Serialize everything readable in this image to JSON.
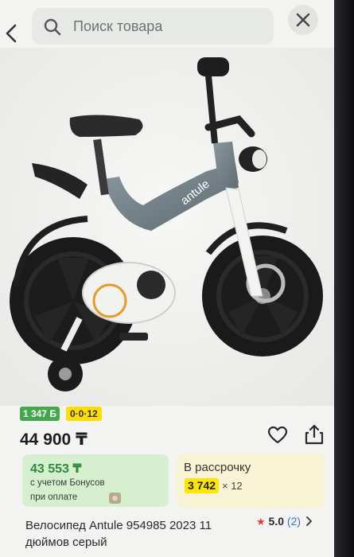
{
  "search": {
    "placeholder": "Поиск товара"
  },
  "badges": {
    "bonus": "1 347 Б",
    "installment": "0·0·12"
  },
  "product": {
    "price": "44 900 ₸",
    "title": "Велосипед Antule 954985 2023 11 дюймов серый",
    "frame_text": "antule",
    "rating": "5.0",
    "review_count": "(2)"
  },
  "bonus_card": {
    "price": "43 553 ₸",
    "note_line1": "с учетом Бонусов",
    "note_line2": "при оплате"
  },
  "installment_card": {
    "title": "В рассрочку",
    "monthly": "3 742",
    "months": "× 12"
  },
  "colors": {
    "bonus_green": "#43a84b",
    "installment_yellow": "#ffdd00",
    "star_red": "#e23b3b",
    "link_blue": "#3b6fd1"
  },
  "icons": {
    "back": "chevron-left-icon",
    "search": "search-icon",
    "close": "close-icon",
    "favorite": "heart-icon",
    "share": "share-icon",
    "rating": "star-icon",
    "more": "chevron-right-icon"
  }
}
